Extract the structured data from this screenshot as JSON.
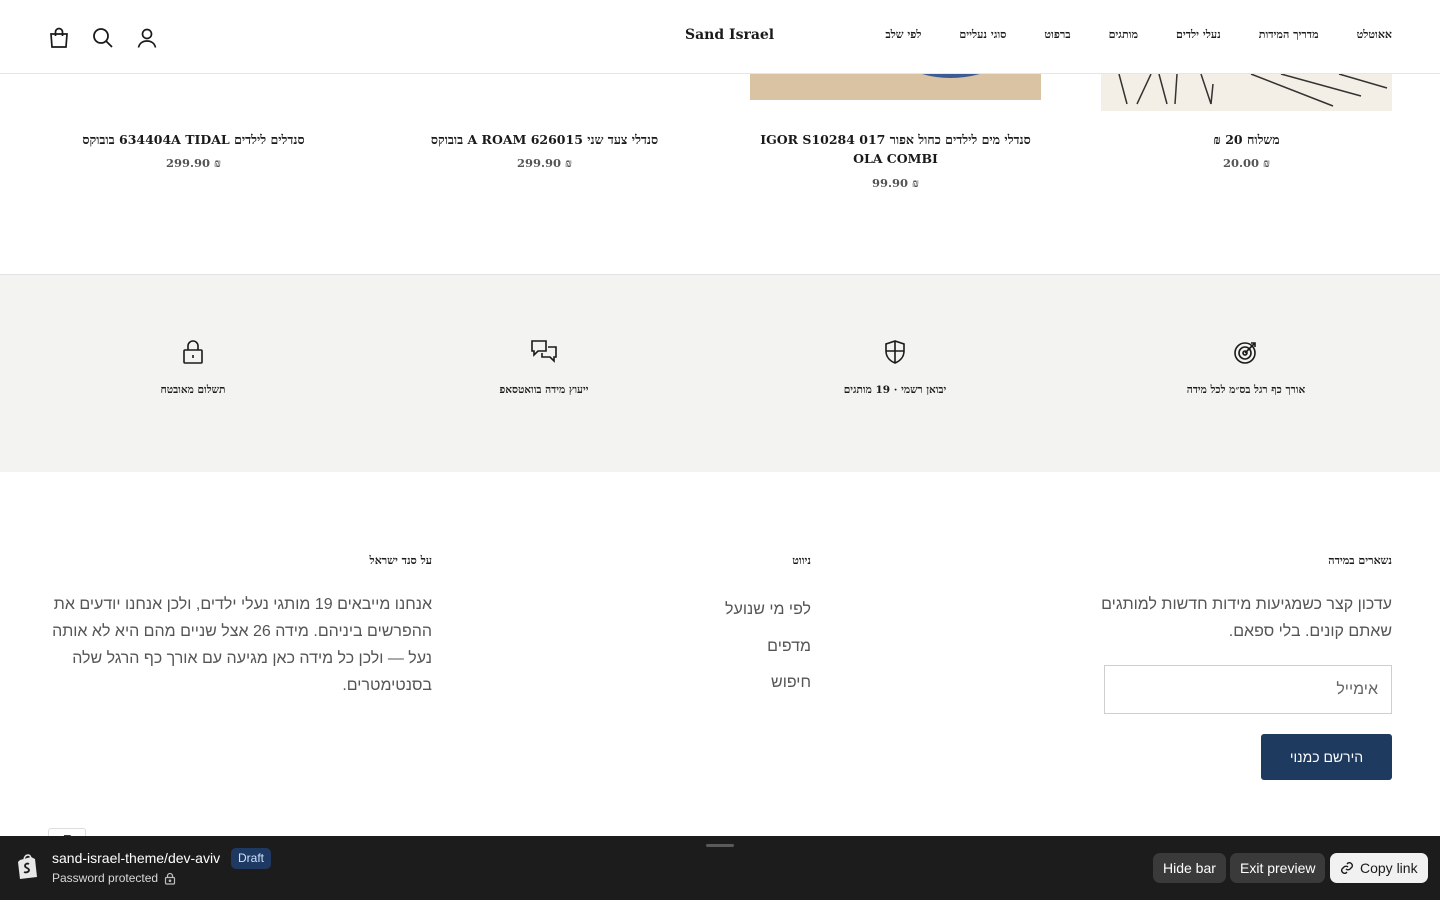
{
  "header": {
    "logo": "Sand Israel",
    "nav": [
      "לפי שלב",
      "סוגי נעליים",
      "ברפוט",
      "מותגים",
      "נעלי ילדים",
      "מדריך המידות",
      "אאוטלט"
    ],
    "icons": [
      "bag-icon",
      "search-icon",
      "account-icon"
    ]
  },
  "products": [
    {
      "title": "משלוח 20 ₪",
      "price": "₪ 20.00"
    },
    {
      "title": "סנדלי מים לילדים כחול אפור IGOR S10284 017 OLA COMBI",
      "price": "₪ 99.90"
    },
    {
      "title": "סנדלי צעד שני A ROAM 626015 בובוקס",
      "price": "₪ 299.90"
    },
    {
      "title": "סנדלים לילדים 634404A TIDAL בובוקס",
      "price": "₪ 299.90"
    }
  ],
  "features": [
    {
      "label": "אורך כף רגל בס״מ לכל מידה",
      "icon": "target-icon"
    },
    {
      "label": "יבואן רשמי · 19 מותגים",
      "icon": "shield-icon"
    },
    {
      "label": "ייעוץ מידה בוואטסאפ",
      "icon": "chat-icon"
    },
    {
      "label": "תשלום מאובטח",
      "icon": "lock-icon"
    }
  ],
  "footer": {
    "newsletter": {
      "title": "נשארים במידה",
      "text": "עדכון קצר כשמגיעות מידות חדשות למותגים שאתם קונים. בלי ספאם.",
      "email_placeholder": "אימייל",
      "button": "הירשם כמנוי"
    },
    "navigation": {
      "title": "ניווט",
      "links": [
        "לפי מי שנועל",
        "מדפים",
        "חיפוש"
      ]
    },
    "about": {
      "title": "על סנד ישראל",
      "text": "אנחנו מייבאים 19 מותגי נעלי ילדים, ולכן אנחנו יודעים את ההפרשים ביניהם. מידה 26 אצל שניים מהם היא לא אותה נעל — ולכן כל מידה כאן מגיעה עם אורך כף הרגל שלה בסנטימטרים."
    }
  },
  "preview_bar": {
    "theme": "sand-israel-theme/dev-aviv",
    "badge": "Draft",
    "status": "Password protected",
    "hide": "Hide bar",
    "exit": "Exit preview",
    "copy": "Copy link"
  },
  "colors": {
    "accent": "#1f3a5f",
    "band": "#f3f3f1",
    "preview_bar": "#1c1c1c"
  }
}
